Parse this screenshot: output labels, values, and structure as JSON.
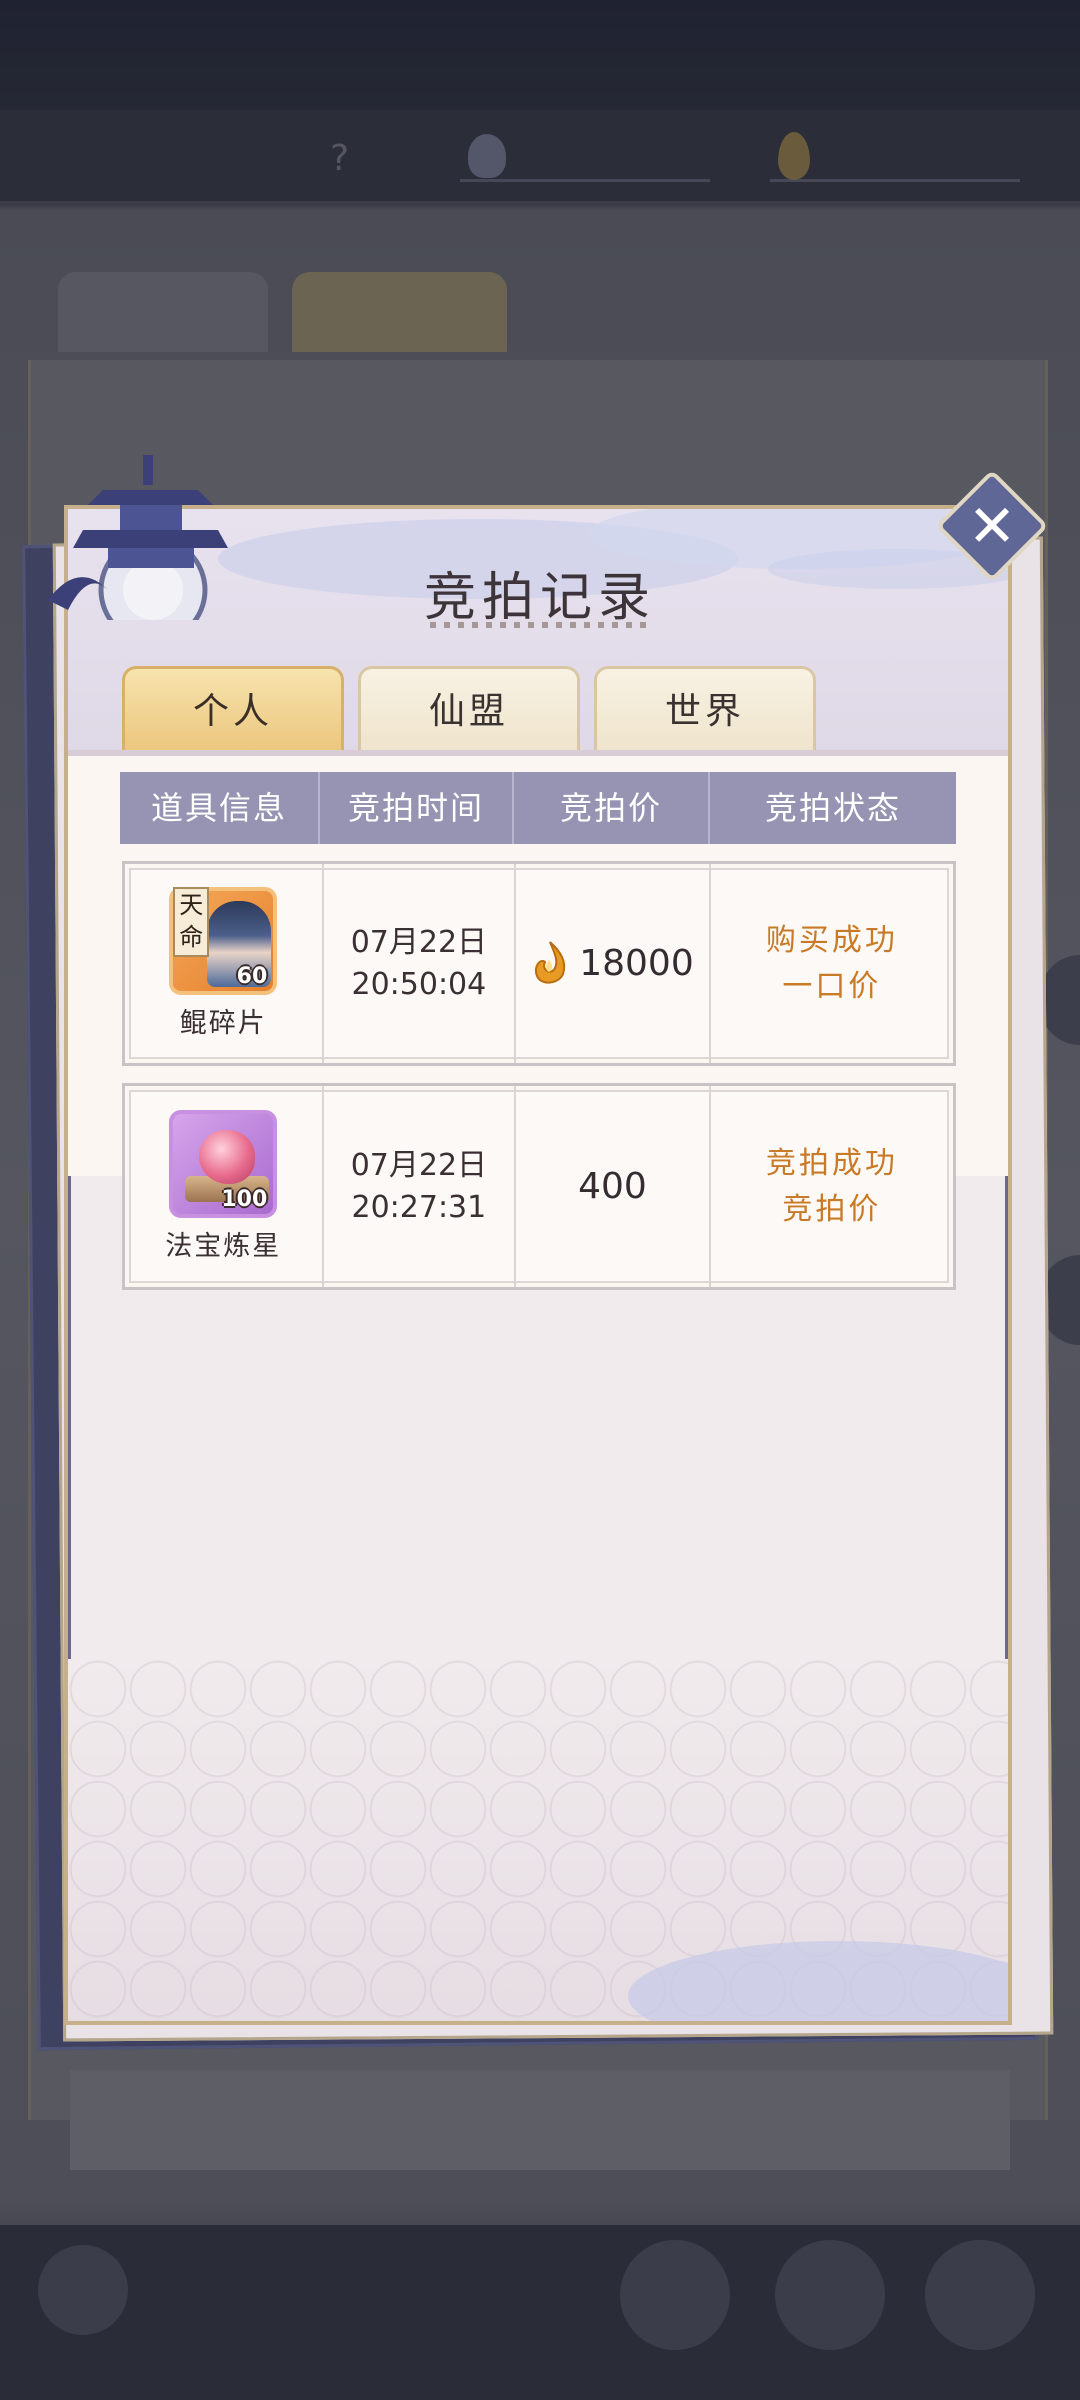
{
  "background": {
    "title": "",
    "tabs": [],
    "board_title": ""
  },
  "modal": {
    "title": "竞拍记录",
    "tabs": [
      {
        "label": "个人",
        "active": true
      },
      {
        "label": "仙盟",
        "active": false
      },
      {
        "label": "世界",
        "active": false
      }
    ],
    "table": {
      "headers": [
        "道具信息",
        "竞拍时间",
        "竞拍价",
        "竞拍状态"
      ],
      "rows": [
        {
          "item_name": "鲲碎片",
          "item_badge": "天命",
          "item_qty": "60",
          "item_icon": "kun-fragment-portrait-icon",
          "date": "07月22日",
          "time": "20:50:04",
          "price": "18000",
          "price_icon": "gold-flame-currency-icon",
          "status_line1": "购买成功",
          "status_line2": "一口价"
        },
        {
          "item_name": "法宝炼星",
          "item_badge": "",
          "item_qty": "100",
          "item_icon": "pink-gem-artifact-icon",
          "date": "07月22日",
          "time": "20:27:31",
          "price": "400",
          "price_icon": "",
          "status_line1": "竞拍成功",
          "status_line2": "竞拍价"
        }
      ]
    }
  },
  "colors": {
    "header_bg": "#9694b2",
    "status_text": "#c97a26",
    "active_tab": "#ebc67e",
    "close_button": "#5f6796"
  }
}
